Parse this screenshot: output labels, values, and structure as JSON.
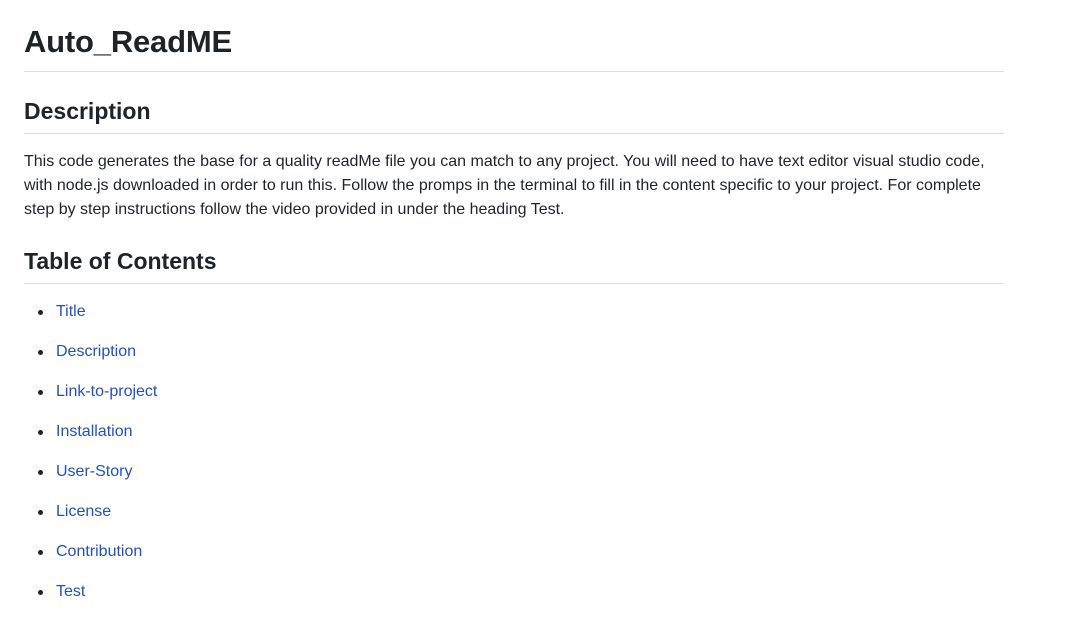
{
  "title": "Auto_ReadME",
  "description": {
    "heading": "Description",
    "text": "This code generates the base for a quality readMe file you can match to any project. You will need to have text editor visual studio code, with node.js downloaded in order to run this. Follow the promps in the terminal to fill in the content specific to your project. For complete step by step instructions follow the video provided in under the heading Test."
  },
  "toc": {
    "heading": "Table of Contents",
    "items": [
      {
        "label": "Title"
      },
      {
        "label": "Description"
      },
      {
        "label": "Link-to-project"
      },
      {
        "label": "Installation"
      },
      {
        "label": "User-Story"
      },
      {
        "label": "License"
      },
      {
        "label": "Contribution"
      },
      {
        "label": "Test"
      }
    ]
  },
  "colors": {
    "text": "#1f2328",
    "link": "#2350c8",
    "divider": "#d8dee4"
  }
}
